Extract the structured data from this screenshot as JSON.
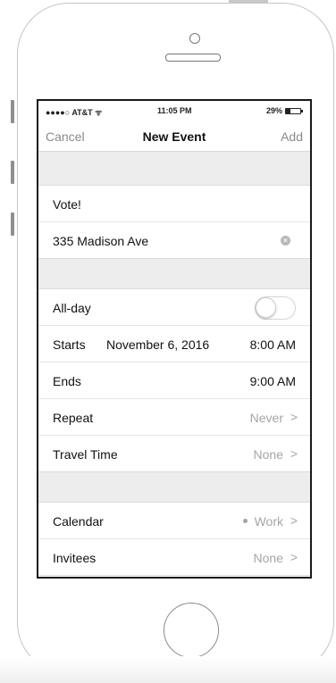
{
  "status_bar": {
    "carrier": "●●●●○ AT&T ᯤ",
    "time": "11:05 PM",
    "battery": "29%"
  },
  "nav": {
    "cancel": "Cancel",
    "title": "New Event",
    "add": "Add"
  },
  "event": {
    "title": "Vote!",
    "location": "335 Madison Ave",
    "clear_icon": "×"
  },
  "details": {
    "all_day_label": "All-day",
    "all_day_on": false,
    "starts_label": "Starts",
    "starts_date": "November 6, 2016",
    "starts_time": "8:00 AM",
    "ends_label": "Ends",
    "ends_time": "9:00 AM",
    "repeat_label": "Repeat",
    "repeat_value": "Never",
    "travel_label": "Travel Time",
    "travel_value": "None"
  },
  "extra": {
    "calendar_label": "Calendar",
    "calendar_value": "Work",
    "invitees_label": "Invitees",
    "invitees_value": "None"
  },
  "chevron": ">",
  "colors": {
    "muted_text": "#a5a5a5",
    "section_gap": "#ededed",
    "screen_border": "#1a1a1a"
  }
}
